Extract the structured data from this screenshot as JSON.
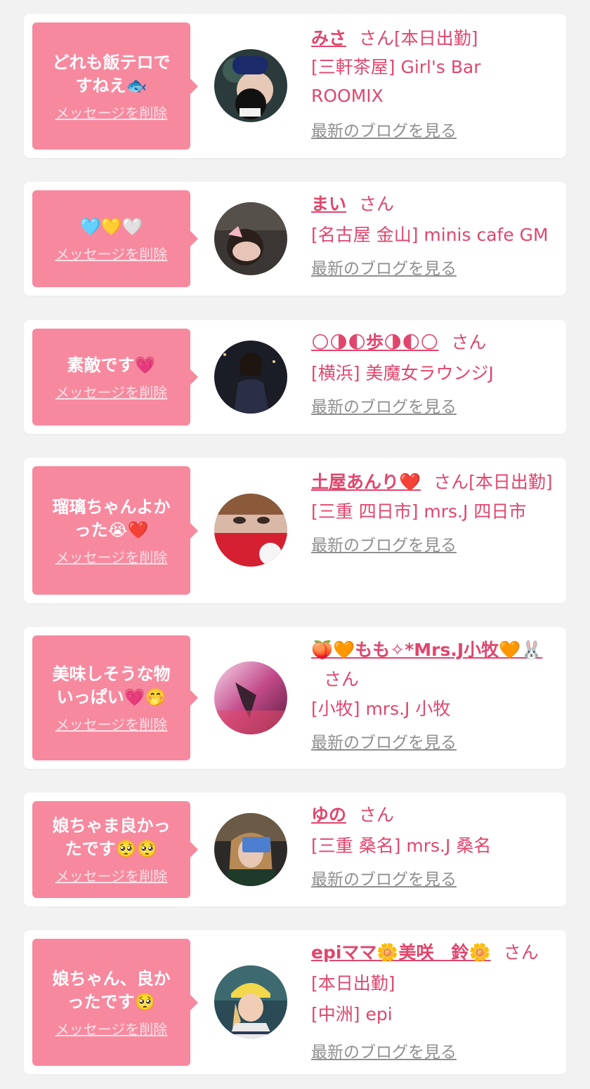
{
  "delete_label": "メッセージを削除",
  "blog_label": "最新のブログを見る",
  "san": "さん",
  "colors": {
    "bubble": "#f7899f",
    "name": "#e0466d",
    "blog": "#8f8f8f"
  },
  "cards": [
    {
      "message": "どれも飯テロですねえ🐟",
      "name": "みさ",
      "status": "[本日出勤]",
      "shop": "[三軒茶屋] Girl's Bar ROOMIX"
    },
    {
      "message": "🩵💛🤍",
      "name": "まい",
      "status": "",
      "shop": "[名古屋 金山] minis cafe GM"
    },
    {
      "message": "素敵です💗",
      "name": "🌕🌗🌓歩🌗🌓🌕",
      "status": "",
      "shop": "[横浜] 美魔女ラウンジJ"
    },
    {
      "message": "瑠璃ちゃんよかった😭❤️",
      "name": "土屋あんり❤️",
      "status": "[本日出勤]",
      "shop": "[三重 四日市] mrs.J 四日市"
    },
    {
      "message": "美味しそうな物いっぱい💗🤭",
      "name": "🍑🧡もも✧*Mrs.J小牧🧡🐰",
      "status": "",
      "shop": "[小牧] mrs.J 小牧"
    },
    {
      "message": "娘ちゃま良かったです🥺🥺",
      "name": "ゆの",
      "status": "",
      "shop": "[三重 桑名] mrs.J 桑名"
    },
    {
      "message": "娘ちゃん、良かったです🥺",
      "name": "epiママ🌼美咲　鈴🌼",
      "status": "[本日出勤]",
      "shop": "[中洲] epi"
    }
  ]
}
